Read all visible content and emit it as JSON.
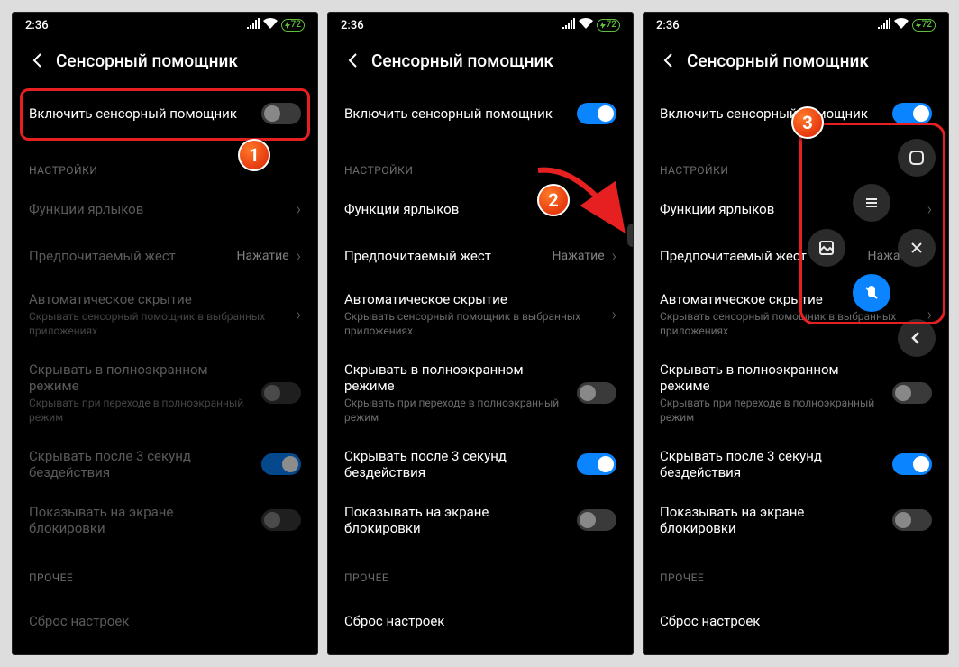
{
  "status": {
    "time": "2:36",
    "battery": "72"
  },
  "header": {
    "title": "Сенсорный помощник"
  },
  "main_toggle_label": "Включить сенсорный помощник",
  "sections": {
    "settings": "НАСТРОЙКИ",
    "other": "ПРОЧЕЕ"
  },
  "rows": {
    "shortcuts": "Функции ярлыков",
    "gesture": "Предпочитаемый жест",
    "gesture_val": "Нажатие",
    "autohide": "Автоматическое скрытие",
    "autohide_sub": "Скрывать сенсорный помощник в выбранных приложениях",
    "fullscreen": "Скрывать в полноэкранном режиме",
    "fullscreen_sub": "Скрывать при переходе в полноэкранный режим",
    "idle3s": "Скрывать после 3 секунд бездействия",
    "lockscreen": "Показывать на экране блокировки",
    "reset": "Сброс настроек"
  },
  "steps": {
    "s1": "1",
    "s2": "2",
    "s3": "3"
  },
  "screens": [
    {
      "main_on": false,
      "disabled": true,
      "idle_on": true
    },
    {
      "main_on": true,
      "disabled": false,
      "idle_on": true
    },
    {
      "main_on": true,
      "disabled": false,
      "idle_on": true
    }
  ]
}
